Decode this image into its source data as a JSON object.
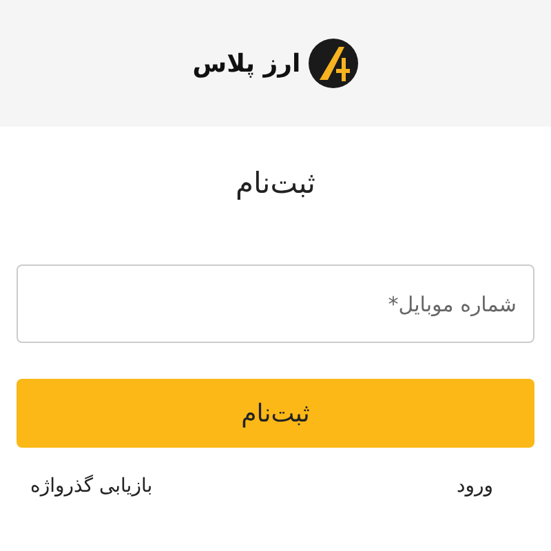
{
  "header": {
    "brand": "ارز پلاس"
  },
  "title": "ثبت‌نام",
  "mobile_field": {
    "placeholder": "شماره موبایل*"
  },
  "submit_button": "ثبت‌نام",
  "links": [
    {
      "label": "ورود"
    },
    {
      "label": "بازیابی گذرواژه"
    }
  ]
}
